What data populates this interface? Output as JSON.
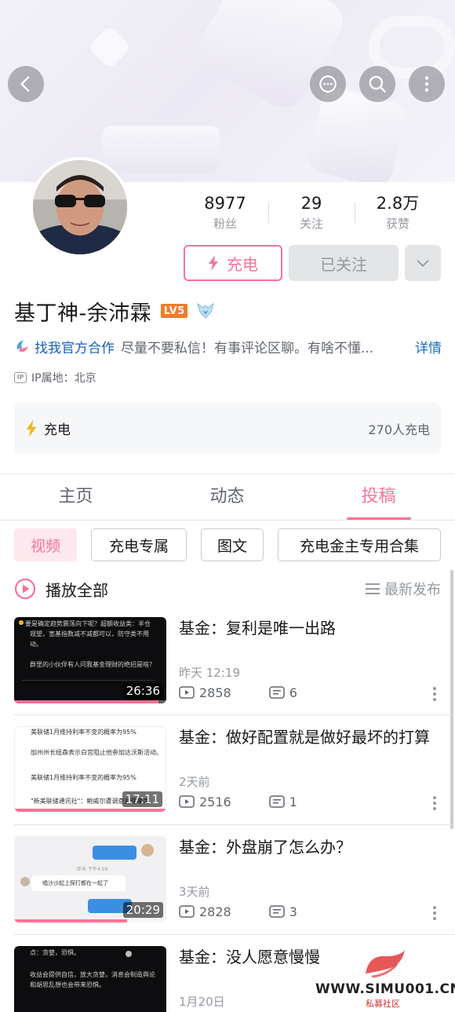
{
  "profile": {
    "name": "基丁神-余沛霖",
    "level": "LV5",
    "stats": [
      {
        "value": "8977",
        "label": "粉丝"
      },
      {
        "value": "29",
        "label": "关注"
      },
      {
        "value": "2.8万",
        "label": "获赞"
      }
    ],
    "charge_button": "充电",
    "followed_button": "已关注",
    "bio_link": "找我官方合作",
    "bio_text": "尽量不要私信！有事评论区聊。有啥不懂...",
    "bio_detail": "详情",
    "ip_label": "IP属地：北京",
    "ip_icon": "IP"
  },
  "charge_card": {
    "label": "充电",
    "count": "270人充电"
  },
  "tabs": [
    {
      "label": "主页",
      "active": false
    },
    {
      "label": "动态",
      "active": false
    },
    {
      "label": "投稿",
      "active": true
    }
  ],
  "chips": [
    {
      "label": "视频",
      "active": true
    },
    {
      "label": "充电专属",
      "active": false
    },
    {
      "label": "图文",
      "active": false
    },
    {
      "label": "充电金主专用合集",
      "active": false
    }
  ],
  "play_all": "播放全部",
  "sort_label": "最新发布",
  "videos": [
    {
      "title": "基金：复利是唯一出路",
      "time": "昨天 12:19",
      "plays": "2858",
      "comments": "6",
      "duration": "26:36",
      "progress": 0.95
    },
    {
      "title": "基金：做好配置就是做好最坏的打算",
      "time": "2天前",
      "plays": "2516",
      "comments": "1",
      "duration": "17:11",
      "progress": 1.0
    },
    {
      "title": "基金：外盘崩了怎么办？",
      "time": "3天前",
      "plays": "2828",
      "comments": "3",
      "duration": "20:29",
      "progress": 0.74
    },
    {
      "title": "基金：没人愿意慢慢",
      "time": "1月20日",
      "plays": "",
      "comments": "",
      "duration": "",
      "progress": 0
    }
  ],
  "thumb_texts": {
    "v1": [
      "要是确定趋势震荡向下呢？超额收益类：半仓",
      "观望，宽基指数减不减都可以，防守类不用",
      "动。",
      "",
      "群里的小伙伴有人问我基金理财的绝招是啥？"
    ],
    "v2": [
      "美联储1月维持利率不变的概率为95%",
      "加州州长纽森表示白宫阻止他参加达沃斯活动。",
      "美联储1月维持利率不变的概率为95%",
      "\"新美联储通讯社\"：鲍威尔遭调查对理事席"
    ],
    "v3": [
      "唱沙沙起上探打都在一起了",
      "昨天 下午4:59"
    ],
    "v4": [
      "点：贪婪，恐惧。",
      "收益会提供自信，放大贪婪。消息会制造舆论",
      "和胡思乱想也会带来恐惧。"
    ]
  },
  "watermark": {
    "text": "WWW.SIMU001.CN",
    "sub": "私募社区"
  },
  "colors": {
    "accent": "#fb7299",
    "link": "#1a5fb4",
    "muted": "#9499a0"
  },
  "icons": [
    "back-arrow-icon",
    "chat-bubble-icon",
    "search-icon",
    "more-vertical-icon",
    "lightning-icon",
    "chevron-down-icon",
    "play-circle-icon",
    "sort-lines-icon",
    "play-count-icon",
    "comment-count-icon"
  ]
}
